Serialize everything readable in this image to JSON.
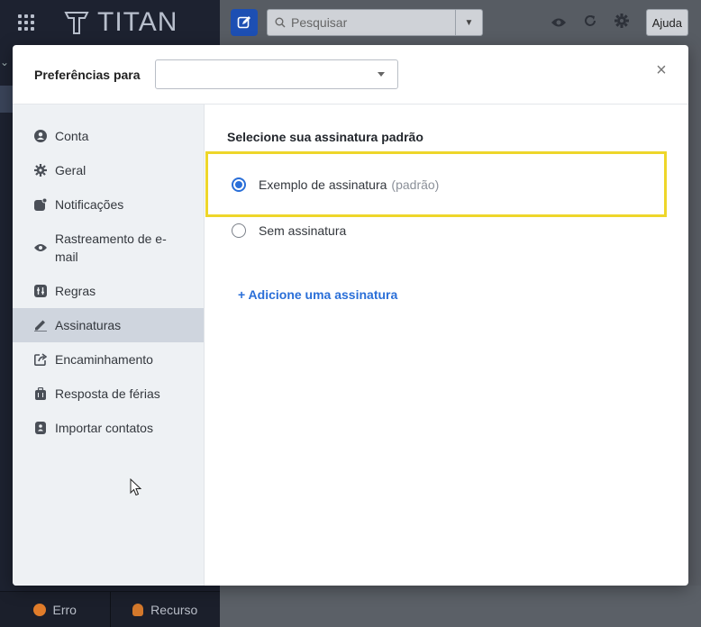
{
  "app": {
    "logo_text": "TITAN",
    "search_placeholder": "Pesquisar",
    "help_label": "Ajuda",
    "bottom": {
      "bug_label": "Erro",
      "feature_label": "Recurso"
    }
  },
  "modal": {
    "title": "Preferências para",
    "selected_account": "",
    "close_icon": "close-icon"
  },
  "sidebar": {
    "items": [
      {
        "label": "Conta",
        "icon": "account-icon"
      },
      {
        "label": "Geral",
        "icon": "gear-icon"
      },
      {
        "label": "Notificações",
        "icon": "notification-icon"
      },
      {
        "label": "Rastreamento de e-mail",
        "icon": "eye-icon"
      },
      {
        "label": "Regras",
        "icon": "rules-icon"
      },
      {
        "label": "Assinaturas",
        "icon": "pen-icon",
        "active": true
      },
      {
        "label": "Encaminhamento",
        "icon": "forward-icon"
      },
      {
        "label": "Resposta de férias",
        "icon": "suitcase-icon"
      },
      {
        "label": "Importar contatos",
        "icon": "contacts-icon"
      }
    ]
  },
  "content": {
    "section_title": "Selecione sua assinatura padrão",
    "options": [
      {
        "label": "Exemplo de assinatura",
        "suffix": "(padrão)",
        "checked": true
      },
      {
        "label": "Sem assinatura",
        "suffix": "",
        "checked": false
      }
    ],
    "add_link": "+ Adicione uma assinatura"
  },
  "colors": {
    "accent": "#2a6fd8",
    "highlight_border": "#eed62a",
    "sidebar_bg": "#eef1f4",
    "sidebar_active": "#cfd5de"
  }
}
